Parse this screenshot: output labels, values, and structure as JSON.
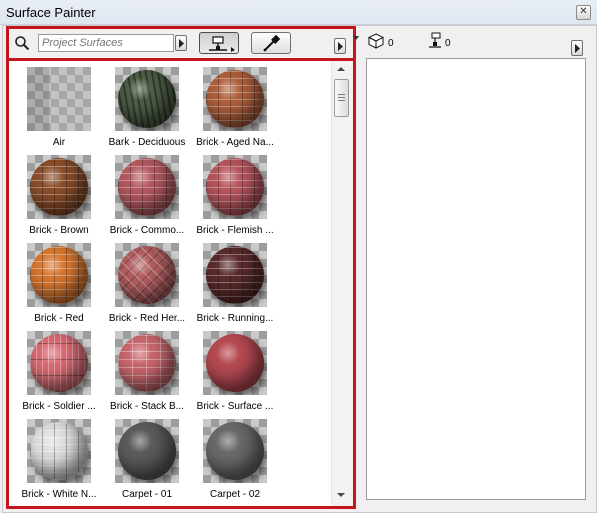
{
  "window": {
    "title": "Surface Painter",
    "close_glyph": "✕"
  },
  "search": {
    "placeholder": "Project Surfaces"
  },
  "counts": {
    "selected_elements": "0",
    "painted_surfaces": "0"
  },
  "surfaces": [
    {
      "label": "Air",
      "base": "#b8b8b8",
      "pattern": "air"
    },
    {
      "label": "Bark - Deciduous",
      "base": "#4f5e46",
      "pattern": "bark"
    },
    {
      "label": "Brick - Aged Na...",
      "base": "#b0603c",
      "pattern": "brick"
    },
    {
      "label": "Brick - Brown",
      "base": "#8c4e2a",
      "pattern": "brick"
    },
    {
      "label": "Brick - Commo...",
      "base": "#b75a61",
      "pattern": "brick"
    },
    {
      "label": "Brick - Flemish ...",
      "base": "#b9565e",
      "pattern": "brick"
    },
    {
      "label": "Brick - Red",
      "base": "#d8772f",
      "pattern": "brick"
    },
    {
      "label": "Brick - Red Her...",
      "base": "#b15e60",
      "pattern": "herring"
    },
    {
      "label": "Brick - Running...",
      "base": "#5b2b2c",
      "pattern": "brick"
    },
    {
      "label": "Brick - Soldier ...",
      "base": "#d96a73",
      "pattern": "soldier"
    },
    {
      "label": "Brick - Stack B...",
      "base": "#c9676d",
      "pattern": "stack"
    },
    {
      "label": "Brick - Surface ...",
      "base": "#b64a52",
      "pattern": "plain"
    },
    {
      "label": "Brick - White N...",
      "base": "#dedede",
      "pattern": "brick"
    },
    {
      "label": "Carpet - 01",
      "base": "#5c5c5c",
      "pattern": "plain"
    },
    {
      "label": "Carpet - 02",
      "base": "#6a6a6a",
      "pattern": "plain"
    }
  ],
  "colors": {
    "highlight_border": "#c4161c"
  },
  "icons": {
    "search": "magnifier-icon",
    "paint_mode": "paint-roller-icon",
    "sample_mode": "eyedropper-icon",
    "element": "cube-icon",
    "painted": "paint-roller-icon",
    "menu": "triangle-right-icon"
  }
}
